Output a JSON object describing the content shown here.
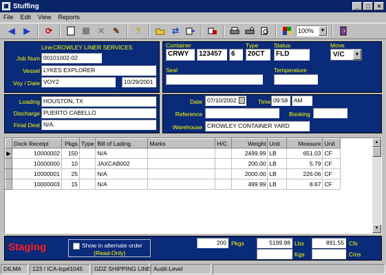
{
  "window": {
    "title": "Stuffing",
    "min": "_",
    "max": "□",
    "close": "×"
  },
  "menu": [
    "File",
    "Edit",
    "View",
    "Reports"
  ],
  "toolbar": {
    "zoom": "100%"
  },
  "header": {
    "line_label": "Line",
    "line_value": "CROWLEY LINER SERVICES",
    "job_label": "Job Num",
    "job_value": "00101002-02",
    "vessel_label": "Vessel",
    "vessel_value": "LYKES EXPLORER",
    "voy_label": "Voy / Date",
    "voy_value": "VOY2",
    "date_value": "10/29/2001",
    "container_label": "Container",
    "container_prefix": "CRWY",
    "container_number": "123457",
    "container_check": "6",
    "type_label": "Type",
    "type_value": "20CT",
    "status_label": "Status",
    "status_value": "FLD",
    "move_label": "Move",
    "move_value": "V/C",
    "seal_label": "Seal",
    "temperature_label": "Temperature"
  },
  "ports": {
    "loading_label": "Loading",
    "loading_value": "HOUSTON, TX",
    "discharge_label": "Discharge",
    "discharge_value": "PUERTO CABELLO",
    "final_label": "Final Dest",
    "final_value": "N/A.",
    "date_label": "Date",
    "date_value": "07/10/2002",
    "time_label": "Time",
    "time_value": "09:58",
    "ampm_value": "AM",
    "reference_label": "Reference",
    "booking_label": "Booking",
    "warehouse_label": "Warehouse",
    "warehouse_value": "CROWLEY CONTAINER YARD"
  },
  "grid": {
    "columns": [
      "Dock Receipt",
      "Pkgs",
      "Type",
      "Bill of Lading",
      "Marks",
      "H/C",
      "Weight",
      "Unit",
      "Measure",
      "Unit"
    ],
    "rows": [
      {
        "receipt": "10000002",
        "pkgs": "150",
        "type": "",
        "bol": "N/A",
        "marks": "",
        "hc": "",
        "weight": "2499.99",
        "wunit": "LB",
        "measure": "651.03",
        "munit": "CF",
        "current": "▶"
      },
      {
        "receipt": "10000000",
        "pkgs": "10",
        "type": "",
        "bol": "JAXCAB002",
        "marks": "",
        "hc": "",
        "weight": "200.00",
        "wunit": "LB",
        "measure": "5.79",
        "munit": "CF",
        "current": ""
      },
      {
        "receipt": "10000001",
        "pkgs": "25",
        "type": "",
        "bol": "N/A",
        "marks": "",
        "hc": "",
        "weight": "2000.00",
        "wunit": "LB",
        "measure": "226.06",
        "munit": "CF",
        "current": ""
      },
      {
        "receipt": "10000003",
        "pkgs": "15",
        "type": "",
        "bol": "N/A",
        "marks": "",
        "hc": "",
        "weight": "499.99",
        "wunit": "LB",
        "measure": "8.67",
        "munit": "CF",
        "current": ""
      }
    ]
  },
  "footer": {
    "staging": "Staging",
    "alt_order_label": "Show in alternate order",
    "readonly_label": "(Read-Only)",
    "pkgs_value": "200",
    "pkgs_label": "Pkgs",
    "lbs_value": "5199.98",
    "lbs_label": "Lbs",
    "cfs_value": "891.55",
    "cfs_label": "Cfs",
    "kgs_label": "Kgs",
    "cms_label": "Cms"
  },
  "statusbar": [
    "DILMA",
    "123 / ICA-tcp#1045",
    "GDZ SHIPPING LINE",
    "Audit-Level"
  ],
  "colors": {
    "panel": "#0a2a7a",
    "label": "#ffff00",
    "staging": "#ff2020",
    "titlebar": "#0a246a"
  }
}
